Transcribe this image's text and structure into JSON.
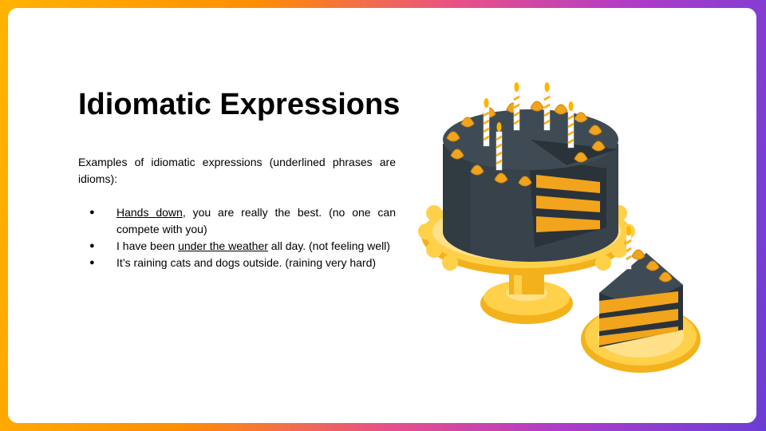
{
  "slide": {
    "title": "Idiomatic Expressions",
    "intro": "Examples of idiomatic expressions (underlined phrases are idioms):",
    "bullet_symbol": "●",
    "bullets": [
      {
        "pre": "",
        "idiom": "Hands down",
        "post": ", you are really the best. (no one can compete with you)"
      },
      {
        "pre": "I have been ",
        "idiom": "under the weather",
        "post": " all day. (not feeling well)"
      },
      {
        "pre": "",
        "idiom": "",
        "post": "It’s raining cats and dogs outside. (raining very hard)"
      }
    ]
  },
  "illustration": {
    "icon": "birthday-cake-icon",
    "colors": {
      "frosting": "#37424a",
      "frosting_dark": "#2a333a",
      "cream": "#f2a41c",
      "cream_dark": "#c98510",
      "stand": "#ffd04a",
      "stand_light": "#ffe18a",
      "stand_dark": "#f3b21c",
      "candle_stripe": "#f5b325",
      "flame": "#ffb400"
    }
  },
  "background": {
    "gradient": [
      "#ffb300",
      "#ff8f00",
      "#e8508a",
      "#b03cc8",
      "#6a3ed6"
    ]
  }
}
